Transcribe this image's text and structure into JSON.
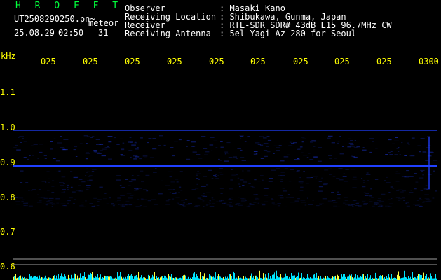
{
  "app": {
    "name": "H R O F F T",
    "filename": "UT2508290250.pn~",
    "date": "25.08.29",
    "time": "02:50",
    "event_label": "meteor",
    "event_count": "31"
  },
  "header": {
    "fields": [
      {
        "label": "Observer",
        "value": "Masaki Kano"
      },
      {
        "label": "Receiving Location",
        "value": "Shibukawa, Gunma, Japan"
      },
      {
        "label": "Receiver",
        "value": "RTL-SDR SDR# 43dB L15 96.7MHz CW"
      },
      {
        "label": "Receiving Antenna",
        "value": "5el Yagi Az 280 for Seoul"
      }
    ]
  },
  "axes": {
    "freq_unit": "kHz",
    "freq_ticks": [
      "1.1",
      "1.0",
      "0.9",
      "0.8",
      "0.7",
      "0.6"
    ],
    "time_ticks": [
      "025",
      "025",
      "025",
      "025",
      "025",
      "025",
      "025",
      "025",
      "025",
      "0300"
    ]
  },
  "colors": {
    "background": "#000000",
    "label_text": "#ffffff",
    "axis_text": "#ffff00",
    "title_text": "#00ff3c",
    "signal": "#2040ff",
    "noise_floor": "#00e5ff",
    "ref_line": "#c8c8c8"
  }
}
